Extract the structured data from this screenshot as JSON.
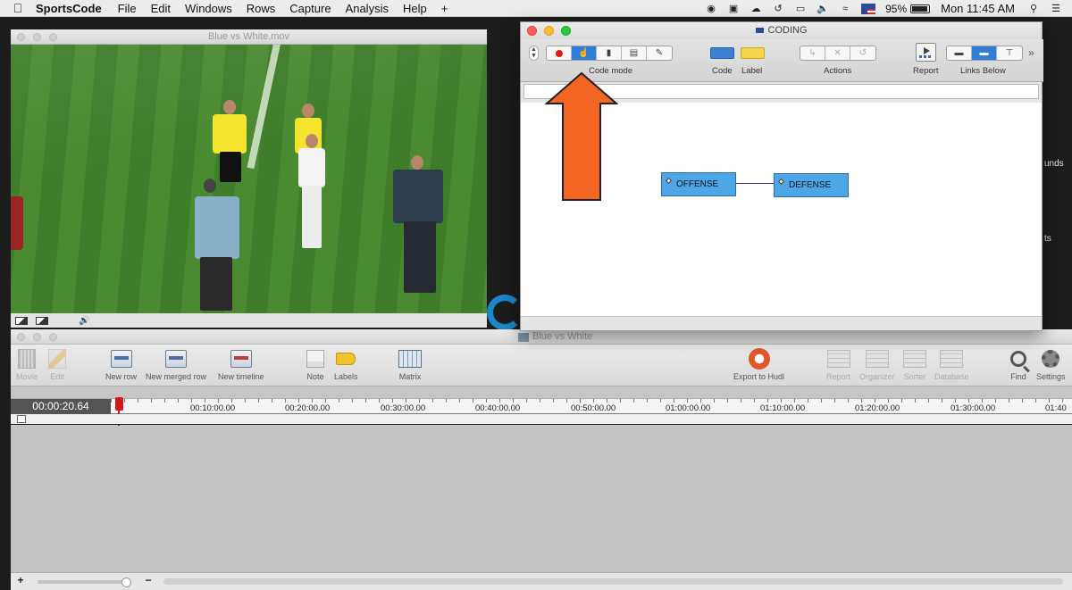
{
  "menubar": {
    "app_name": "SportsCode",
    "items": [
      "File",
      "Edit",
      "Windows",
      "Rows",
      "Capture",
      "Analysis",
      "Help",
      "+"
    ],
    "battery": "95%",
    "clock": "Mon 11:45 AM"
  },
  "video_window": {
    "title": "Blue vs White.mov"
  },
  "coding_window": {
    "title": "CODING",
    "labels": {
      "code_mode": "Code mode",
      "code": "Code",
      "label": "Label",
      "actions": "Actions",
      "report": "Report",
      "links_below": "Links Below"
    },
    "code_buttons": [
      {
        "label": "OFFENSE"
      },
      {
        "label": "DEFENSE"
      }
    ],
    "colors": {
      "code_blue": "#4da6e8",
      "label_yellow": "#f2d54a",
      "active_segment": "#2f7fd6",
      "record_red": "#e01a1a"
    }
  },
  "main_window": {
    "title": "Blue vs White",
    "toolbar": {
      "movie": "Movie",
      "edit": "Edit",
      "new_row": "New row",
      "new_merged_row": "New merged row",
      "new_timeline": "New timeline",
      "note": "Note",
      "labels": "Labels",
      "matrix": "Matrix",
      "export_hudl": "Export to Hudl",
      "report": "Report",
      "organizer": "Organizer",
      "sorter": "Sorter",
      "database": "Database",
      "find": "Find",
      "settings": "Settings"
    },
    "timecode": "00:00:20.64",
    "ruler_ticks": [
      "00:10:00.00",
      "00:20:00.00",
      "00:30:00.00",
      "00:40:00.00",
      "00:50:00.00",
      "01:00:00.00",
      "01:10:00.00",
      "01:20:00.00",
      "01:30:00.00",
      "01:40"
    ]
  },
  "background_fragments": {
    "right_1": "unds",
    "right_2": "ts"
  },
  "annotation": {
    "arrow_color": "#f26522"
  }
}
